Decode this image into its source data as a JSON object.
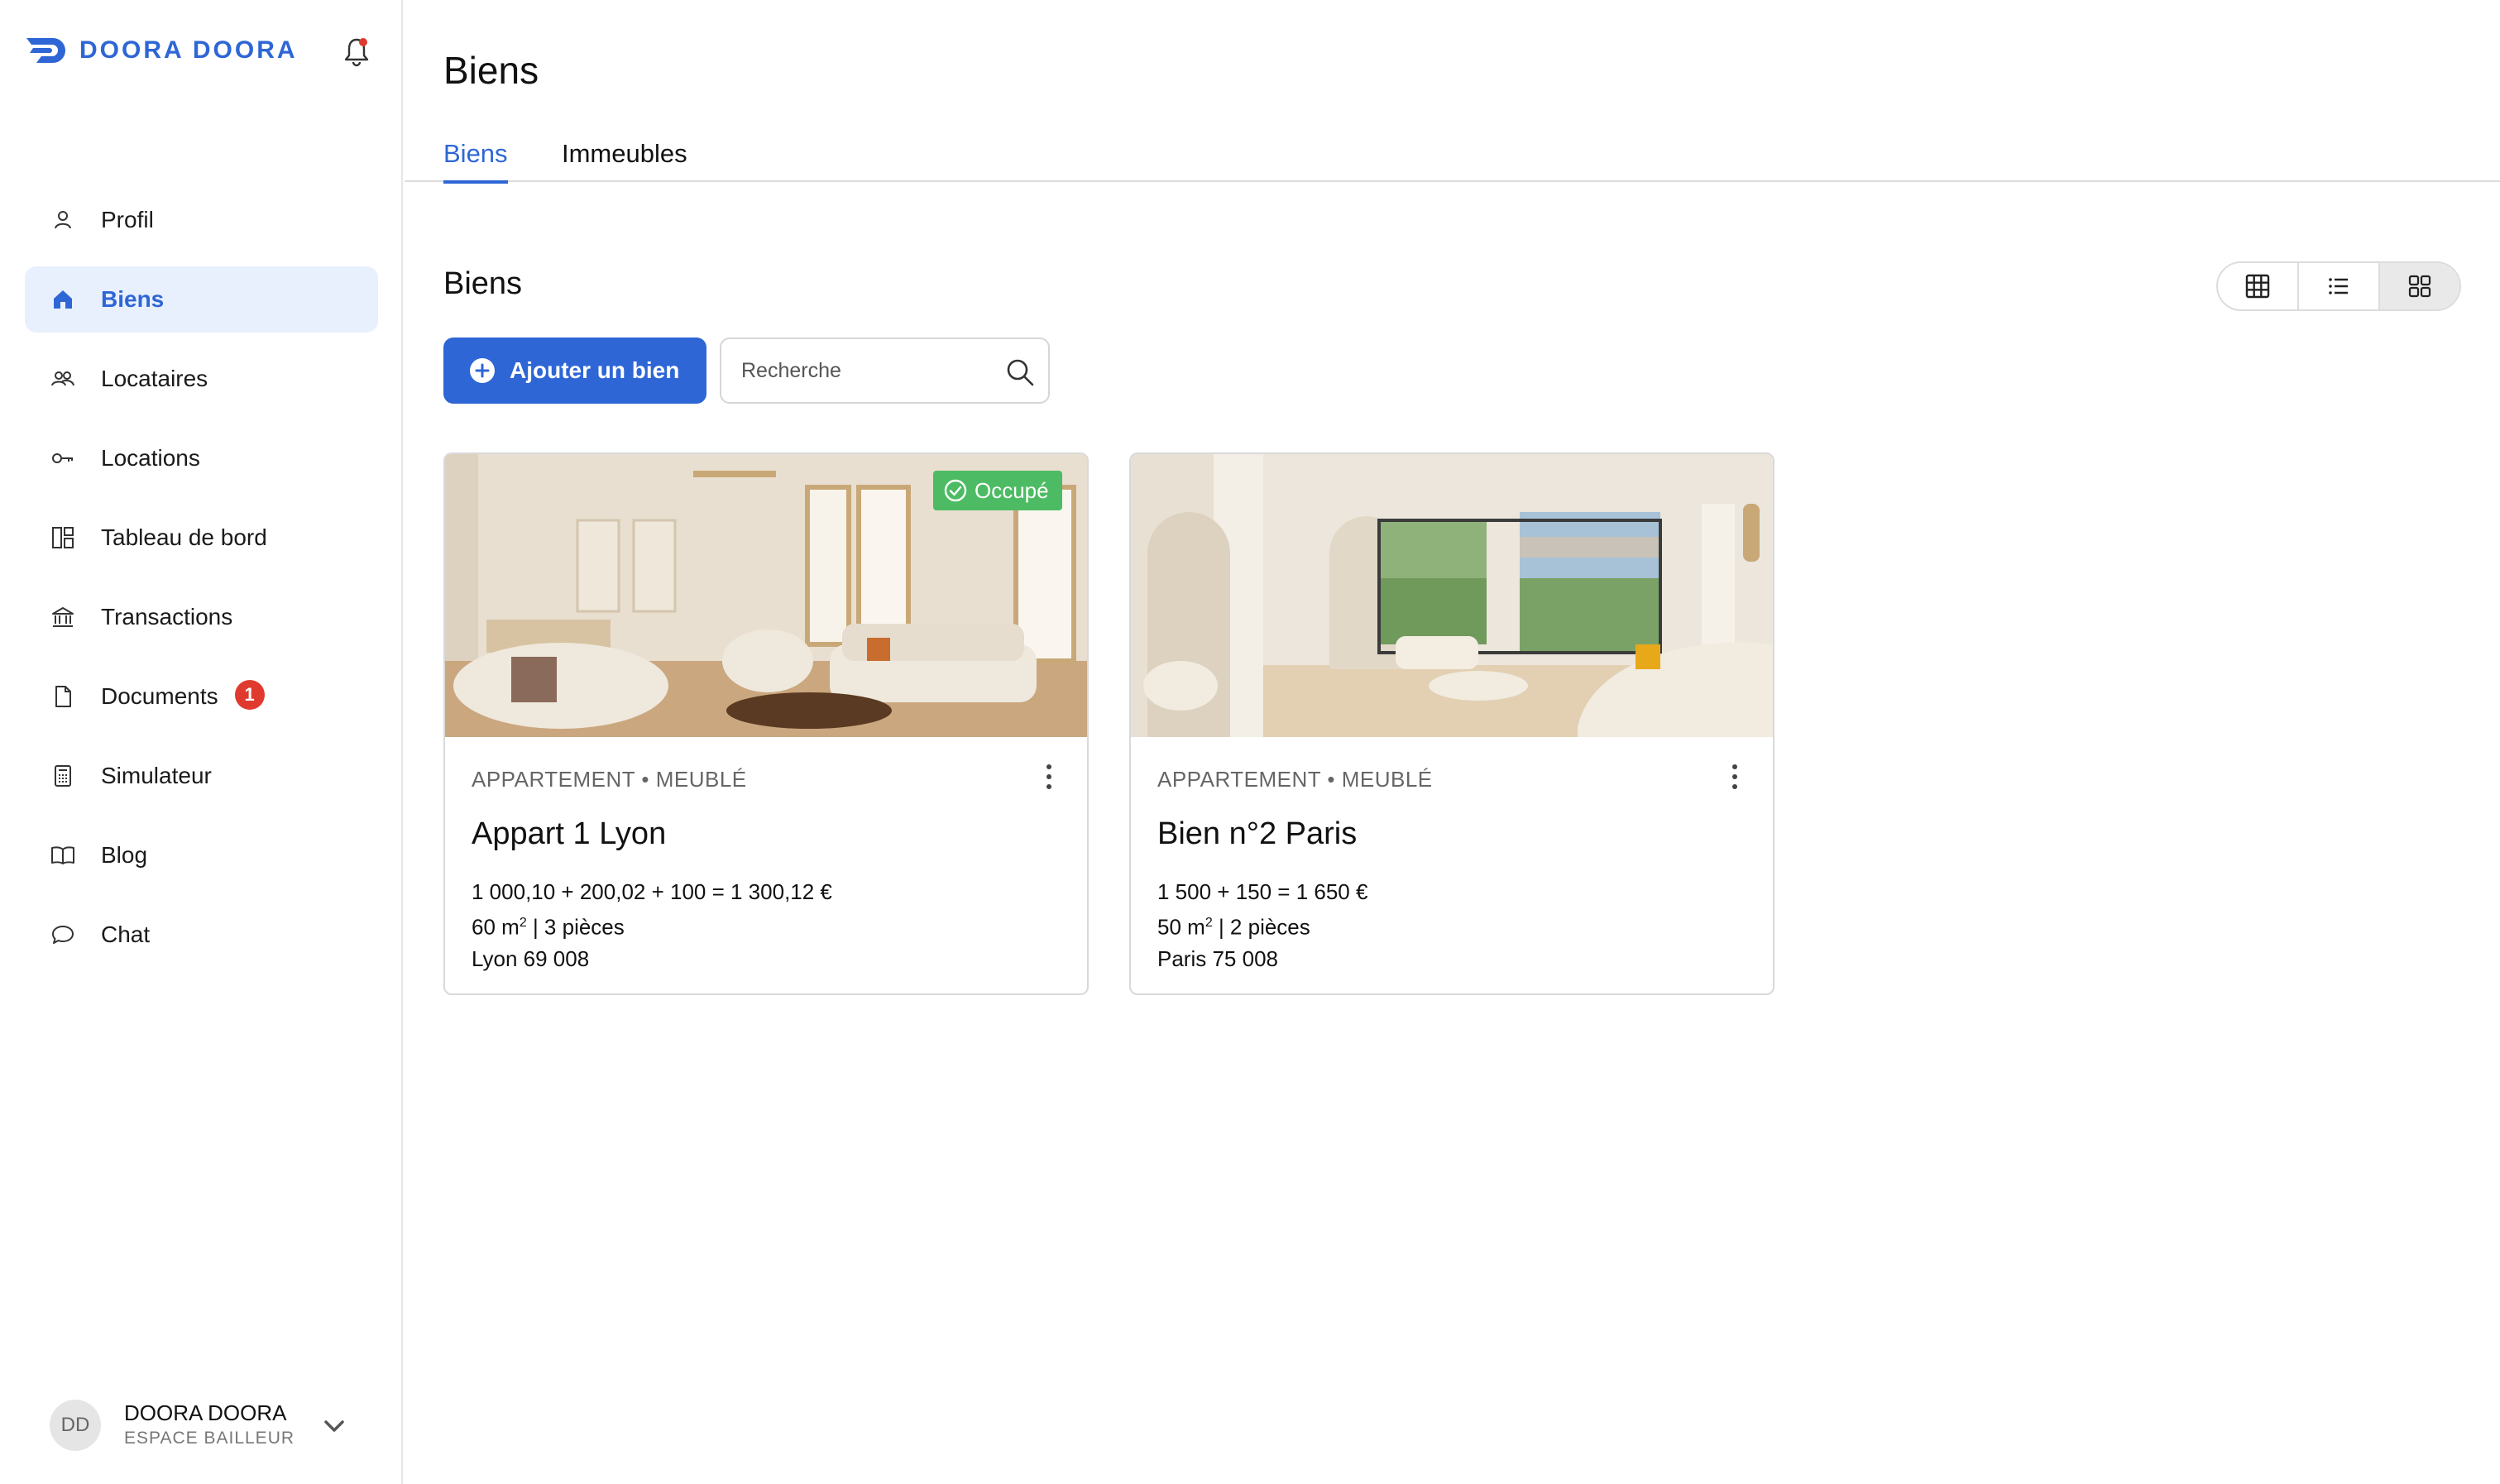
{
  "brand": {
    "name": "DOORA DOORA",
    "color": "#2e66d6"
  },
  "sidebar": {
    "items": [
      {
        "label": "Profil",
        "icon": "user-icon"
      },
      {
        "label": "Biens",
        "icon": "home-icon",
        "active": true
      },
      {
        "label": "Locataires",
        "icon": "users-icon"
      },
      {
        "label": "Locations",
        "icon": "key-icon"
      },
      {
        "label": "Tableau de bord",
        "icon": "dashboard-icon"
      },
      {
        "label": "Transactions",
        "icon": "bank-icon"
      },
      {
        "label": "Documents",
        "icon": "document-icon",
        "badge": "1"
      },
      {
        "label": "Simulateur",
        "icon": "calculator-icon"
      },
      {
        "label": "Blog",
        "icon": "book-icon"
      },
      {
        "label": "Chat",
        "icon": "chat-icon"
      }
    ]
  },
  "user": {
    "initials": "DD",
    "name": "DOORA DOORA",
    "role": "ESPACE BAILLEUR"
  },
  "header": {
    "title": "Biens",
    "tabs": [
      {
        "label": "Biens",
        "active": true
      },
      {
        "label": "Immeubles"
      }
    ]
  },
  "section": {
    "title": "Biens",
    "add_label": "Ajouter un bien",
    "search_placeholder": "Recherche",
    "view_modes": [
      "table-view-icon",
      "list-view-icon",
      "grid-view-icon"
    ],
    "active_view": "grid-view-icon"
  },
  "cards": [
    {
      "badge": "Occupé",
      "type": "APPARTEMENT • MEUBLÉ",
      "title": "Appart 1 Lyon",
      "rent": "1 000,10 + 200,02 + 100 = 1 300,12 €",
      "area": "60 m",
      "area_exp": "2",
      "rooms": " | 3 pièces",
      "city": "Lyon 69 008"
    },
    {
      "type": "APPARTEMENT • MEUBLÉ",
      "title": "Bien n°2 Paris",
      "rent": "1 500 + 150 = 1 650 €",
      "area": "50 m",
      "area_exp": "2",
      "rooms": " | 2 pièces",
      "city": "Paris 75 008"
    }
  ],
  "colors": {
    "accent": "#2e66d6",
    "active_nav_bg": "#e8f0fd",
    "badge_red": "#e03a2f",
    "occupied_green": "#4dbb63"
  }
}
